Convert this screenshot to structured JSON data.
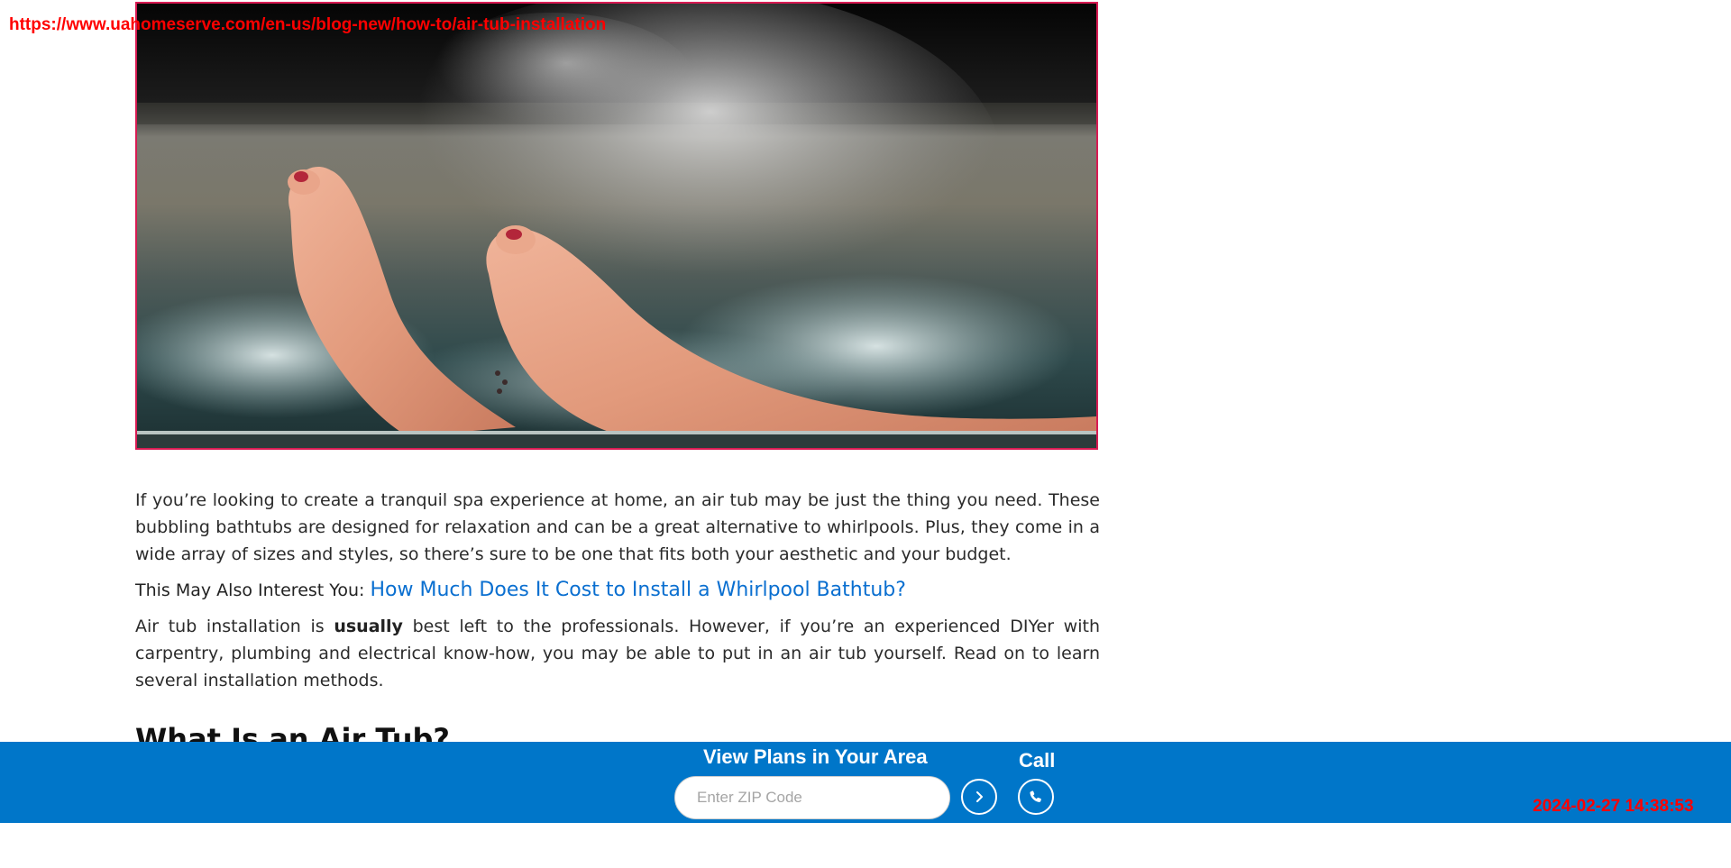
{
  "browser": {
    "url": "https://www.uahomeserve.com/en-us/blog-new/how-to/air-tub-installation"
  },
  "hero_image": {
    "icon": "bath-feet-photo"
  },
  "article": {
    "intro": "If you’re looking to create a tranquil spa experience at home, an air tub may be just the thing you need. These bubbling bathtubs are designed for relaxation and can be a great alternative to whirlpools. Plus, they come in a wide array of sizes and styles, so there’s sure to be one that fits both your aesthetic and your budget.",
    "interest_lead": "This May Also Interest You:",
    "interest_link": "How Much Does It Cost to Install a Whirlpool Bathtub?",
    "p2_start": "Air tub installation is",
    "p2_bold": "usually",
    "p2_end": "best left to the professionals. However, if you’re an experienced DIYer with carpentry, plumbing and electrical know-how, you may be able to put in an air tub yourself. Read on to learn several installation methods.",
    "heading": "What Is an Air Tub?"
  },
  "bottom_bar": {
    "title": "View Plans in Your Area",
    "zip_placeholder": "Enter ZIP Code",
    "zip_value": "",
    "call_label": "Call",
    "accent_color": "#0076c9",
    "go_icon": "chevron-right-icon",
    "call_icon": "phone-icon"
  },
  "overlay": {
    "timestamp": "2024-02-27 14:38:53"
  }
}
